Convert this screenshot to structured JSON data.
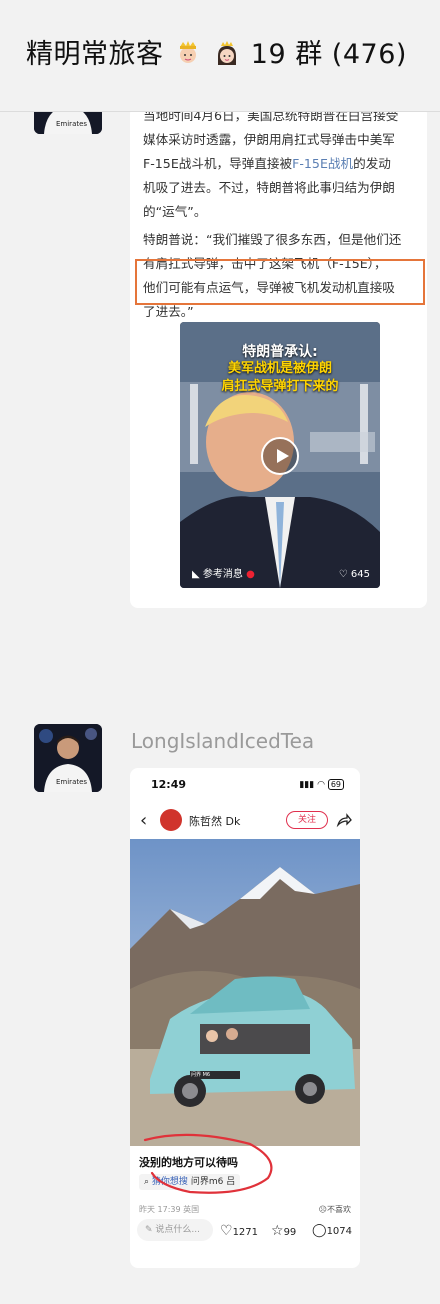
{
  "header": {
    "group_name": "精明常旅客",
    "group_suffix": "19 群 (476)"
  },
  "article_card": {
    "paragraph1_line1": "当地时间4月6日，美国总统特朗普在白宫接受",
    "paragraph1_line2": "媒体采访时透露，伊朗用肩扛式导弹击中美军",
    "paragraph1_line3_pre": "F-15E战斗机，导弹直接被",
    "paragraph1_link": "F-15E战机",
    "paragraph1_line3_post": "的发动",
    "paragraph1_line4": "机吸了进去。不过，特朗普将此事归结为伊朗",
    "paragraph1_line5": "的“运气”。",
    "paragraph2_line1": "特朗普说：“我们摧毁了很多东西，但是他们还",
    "paragraph2_line2": "有肩扛式导弹，击中了这架飞机（F-15E），",
    "paragraph2_line3": "他们可能有点运气，导弹被飞机发动机直接吸",
    "paragraph2_line4": "了进去。”",
    "video": {
      "caption_line1": "特朗普承认:",
      "caption_line2": "美军战机是被伊朗",
      "caption_line3": "肩扛式导弹打下来的",
      "source": "参考消息",
      "likes": "645"
    }
  },
  "second_message": {
    "sender": "LongIslandIcedTea",
    "phone": {
      "time": "12:49",
      "battery": "69",
      "author": "陈哲然 Dk",
      "follow_label": "关注",
      "post_title": "没别的地方可以待吗",
      "search_prefix": "猜你想搜",
      "search_query": "问界m6",
      "search_suffix": "吕",
      "meta": "昨天 17:39 英国",
      "dislike_label": "不喜欢",
      "comment_placeholder": "说点什么...",
      "likes": "1271",
      "stars": "99",
      "comments": "1074",
      "car_badge": "问界 M6"
    }
  }
}
